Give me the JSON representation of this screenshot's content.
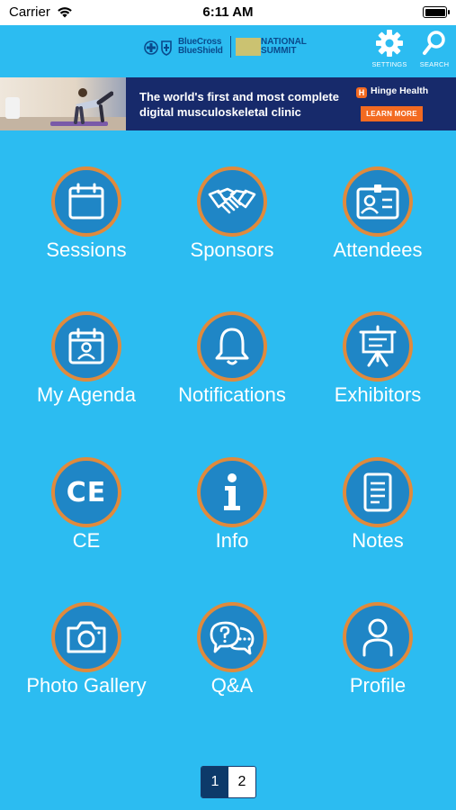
{
  "status_bar": {
    "carrier": "Carrier",
    "time": "6:11 AM"
  },
  "header": {
    "logo": {
      "bcbs_line1": "BlueCross",
      "bcbs_line2": "BlueShield",
      "summit_line1": "NATIONAL",
      "summit_line2": "SUMMIT"
    },
    "settings_label": "SETTINGS",
    "search_label": "SEARCH"
  },
  "banner": {
    "line1": "The world's first and most complete",
    "line2": "digital musculoskeletal clinic",
    "brand": "Hinge Health",
    "brand_mark": "H",
    "cta": "LEARN MORE"
  },
  "tiles": [
    {
      "label": "Sessions",
      "icon": "calendar-icon"
    },
    {
      "label": "Sponsors",
      "icon": "handshake-icon"
    },
    {
      "label": "Attendees",
      "icon": "id-badge-icon"
    },
    {
      "label": "My Agenda",
      "icon": "agenda-person-icon"
    },
    {
      "label": "Notifications",
      "icon": "bell-icon"
    },
    {
      "label": "Exhibitors",
      "icon": "easel-icon"
    },
    {
      "label": "CE",
      "icon": "ce-text-icon",
      "icon_text": "CE"
    },
    {
      "label": "Info",
      "icon": "info-icon"
    },
    {
      "label": "Notes",
      "icon": "notes-icon"
    },
    {
      "label": "Photo Gallery",
      "icon": "camera-icon"
    },
    {
      "label": "Q&A",
      "icon": "chat-question-icon"
    },
    {
      "label": "Profile",
      "icon": "person-icon"
    }
  ],
  "pagination": {
    "pages": [
      "1",
      "2"
    ],
    "current": "1"
  },
  "colors": {
    "background": "#2cbcf1",
    "tile_fill": "#1f86c6",
    "tile_ring": "#e08a3c",
    "banner_bg": "#172a6b",
    "cta_orange": "#f36a21",
    "pager_active": "#0d3a6a"
  }
}
